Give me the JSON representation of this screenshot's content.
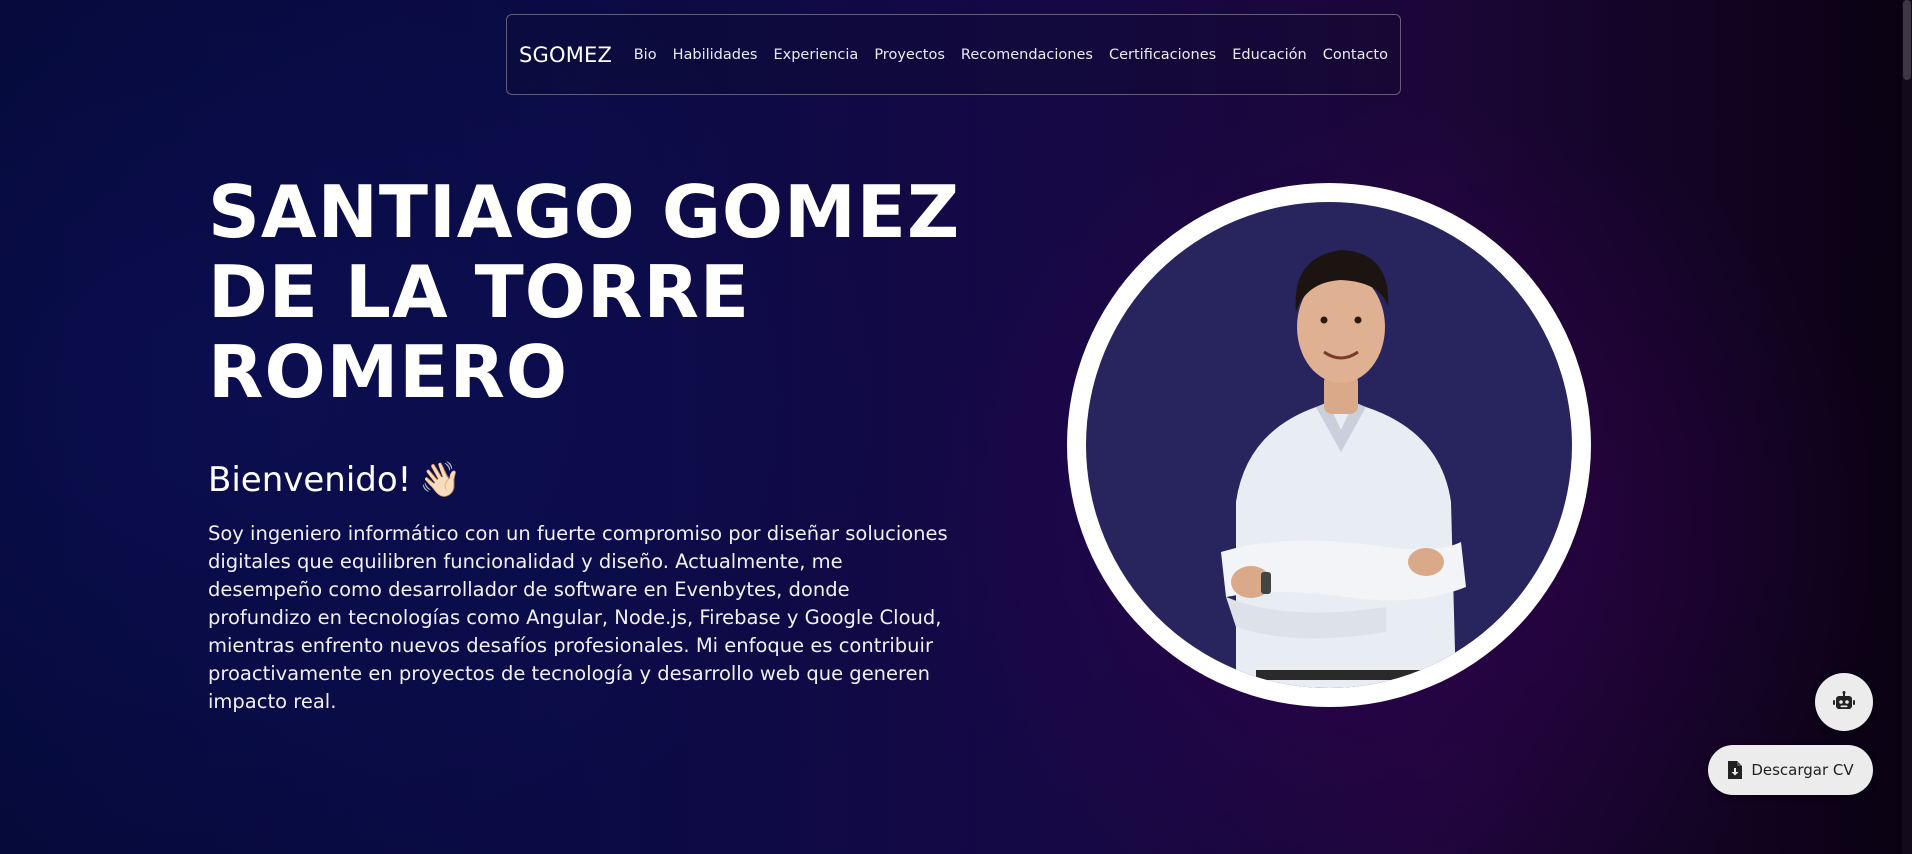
{
  "navbar": {
    "brand": "SGOMEZ",
    "links": [
      "Bio",
      "Habilidades",
      "Experiencia",
      "Proyectos",
      "Recomendaciones",
      "Certificaciones",
      "Educación",
      "Contacto"
    ]
  },
  "hero": {
    "name_lines": [
      "SANTIAGO GOMEZ",
      "DE LA TORRE",
      "ROMERO"
    ],
    "welcome": "Bienvenido!",
    "welcome_emoji": "👋🏻",
    "bio": "Soy ingeniero informático con un fuerte compromiso por diseñar soluciones digitales que equilibren funcionalidad y diseño. Actualmente, me desempeño como desarrollador de software en Evenbytes, donde profundizo en tecnologías como Angular, Node.js, Firebase y Google Cloud, mientras enfrento nuevos desafíos profesionales. Mi enfoque es contribuir proactivamente en proyectos de tecnología y desarrollo web que generen impacto real."
  },
  "actions": {
    "bot_icon": "robot-icon",
    "download_icon": "file-download-icon",
    "download_cv_label": "Descargar CV"
  },
  "colors": {
    "background_start": "#050a3a",
    "background_end": "#1c0638",
    "avatar_bg": "#28255e",
    "button_bg": "#ececec"
  }
}
